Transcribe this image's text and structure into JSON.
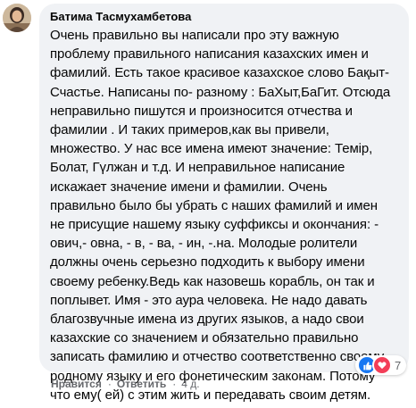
{
  "comment": {
    "author": "Батима Тасмухамбетова",
    "text": "Очень правильно вы написали про эту важную\nпроблему правильного написания казахских имен и\nфамилий. Есть такое красивое казахское слово Бақыт-\nСчастье. Написаны по- разному : БаХыт,БаГит. Отсюда\nнеправильно пишутся и произносится отчества и\nфамилии . И таких примеров,как вы привели,\nмножество. У нас все имена имеют значение: Темір,\nБолат, Гүлжан и т.д. И неправильное написание\nискажает значение имени и фамилии. Очень\nправильно было бы убрать с наших фамилий и имен\nне присущие нашему языку суффиксы и окончания: -\nович,- овна, - в, - ва, - ин, -.на. Молодые ролители\nдолжны очень серьезно подходить к выбору имени\nсвоему ребенку.Ведь как назовешь корабль, он так и\nпоплывет. Имя - это аура человека. Не надо давать\nблагозвучные имена из других языков, а надо свои\nказахские со значением и обязательно правильно\nзаписать фамилию и отчество соответственно своему\nродному языку и его фонетическим законам. Потому\nчто ему( ей) с этим жить и передавать своим детям."
  },
  "actions": {
    "like_label": "Нравится",
    "reply_label": "Ответить",
    "separator": "·",
    "timestamp": "4 д."
  },
  "reactions": {
    "icons": [
      "like-icon",
      "love-icon"
    ],
    "count": "7",
    "colors": {
      "like": "#1877f2",
      "love": "#f33e58"
    }
  }
}
